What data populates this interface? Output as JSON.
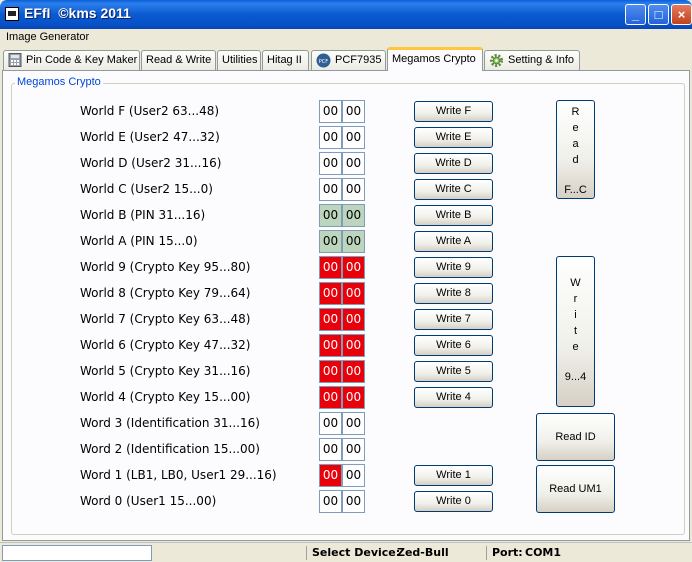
{
  "window": {
    "title": "EFfI  ©kms 2011",
    "minimize": "_",
    "maximize": "□",
    "close": "×"
  },
  "menu": {
    "items": [
      "Image Generator"
    ]
  },
  "tabs": [
    {
      "label": "Pin Code & Key Maker",
      "icon": "calculator-icon"
    },
    {
      "label": "Read & Write"
    },
    {
      "label": "Utilities"
    },
    {
      "label": "Hitag II"
    },
    {
      "label": "PCF7935",
      "icon": "pcf-icon",
      "icon_text": "PCF"
    },
    {
      "label": "Megamos Crypto",
      "active": true
    },
    {
      "label": "Setting & Info",
      "icon": "gear-icon"
    }
  ],
  "group_title": "Megamos Crypto",
  "rows": [
    {
      "label": "World F (User2 63...48)",
      "bytes": [
        "00",
        "00"
      ],
      "colors": [
        "white",
        "white"
      ],
      "button": "Write F"
    },
    {
      "label": "World E (User2 47...32)",
      "bytes": [
        "00",
        "00"
      ],
      "colors": [
        "white",
        "white"
      ],
      "button": "Write E"
    },
    {
      "label": "World D (User2 31...16)",
      "bytes": [
        "00",
        "00"
      ],
      "colors": [
        "white",
        "white"
      ],
      "button": "Write D"
    },
    {
      "label": "World C (User2 15...0)",
      "bytes": [
        "00",
        "00"
      ],
      "colors": [
        "white",
        "white"
      ],
      "button": "Write C"
    },
    {
      "label": "World B (PIN 31...16)",
      "bytes": [
        "00",
        "00"
      ],
      "colors": [
        "green",
        "green"
      ],
      "button": "Write B"
    },
    {
      "label": "World A (PIN 15...0)",
      "bytes": [
        "00",
        "00"
      ],
      "colors": [
        "green",
        "green"
      ],
      "button": "Write A"
    },
    {
      "label": "World 9 (Crypto Key 95...80)",
      "bytes": [
        "00",
        "00"
      ],
      "colors": [
        "red",
        "red"
      ],
      "button": "Write 9"
    },
    {
      "label": "World 8 (Crypto Key 79...64)",
      "bytes": [
        "00",
        "00"
      ],
      "colors": [
        "red",
        "red"
      ],
      "button": "Write 8"
    },
    {
      "label": "World 7 (Crypto Key 63...48)",
      "bytes": [
        "00",
        "00"
      ],
      "colors": [
        "red",
        "red"
      ],
      "button": "Write 7"
    },
    {
      "label": "World 6 (Crypto Key 47...32)",
      "bytes": [
        "00",
        "00"
      ],
      "colors": [
        "red",
        "red"
      ],
      "button": "Write 6"
    },
    {
      "label": "World 5 (Crypto Key 31...16)",
      "bytes": [
        "00",
        "00"
      ],
      "colors": [
        "red",
        "red"
      ],
      "button": "Write 5"
    },
    {
      "label": "World 4 (Crypto Key 15...00)",
      "bytes": [
        "00",
        "00"
      ],
      "colors": [
        "red",
        "red"
      ],
      "button": "Write 4"
    },
    {
      "label": "Word 3 (Identification 31...16)",
      "bytes": [
        "00",
        "00"
      ],
      "colors": [
        "white",
        "white"
      ],
      "button": ""
    },
    {
      "label": "Word 2 (Identification 15...00)",
      "bytes": [
        "00",
        "00"
      ],
      "colors": [
        "white",
        "white"
      ],
      "button": ""
    },
    {
      "label": "Word 1 (LB1, LB0, User1 29...16)",
      "bytes": [
        "00",
        "00"
      ],
      "colors": [
        "red",
        "white"
      ],
      "button": "Write 1"
    },
    {
      "label": "Word 0 (User1 15...00)",
      "bytes": [
        "00",
        "00"
      ],
      "colors": [
        "white",
        "white"
      ],
      "button": "Write 0"
    }
  ],
  "side_buttons": {
    "read_fc": {
      "chars": [
        "R",
        "e",
        "a",
        "d"
      ],
      "range": "F...C"
    },
    "write_94": {
      "chars": [
        "W",
        "r",
        "i",
        "t",
        "e"
      ],
      "range": "9...4"
    },
    "read_id": "Read ID",
    "read_um1": "Read UM1"
  },
  "status": {
    "device_label": "Select Device:",
    "device_value": "Zed-Bull",
    "port_label": "Port:",
    "port_value": "COM1"
  },
  "colors": {
    "red": "#e8000b",
    "green": "#bdd5bd",
    "tab_highlight": "#ffc83c",
    "group_title": "#0046d5"
  }
}
